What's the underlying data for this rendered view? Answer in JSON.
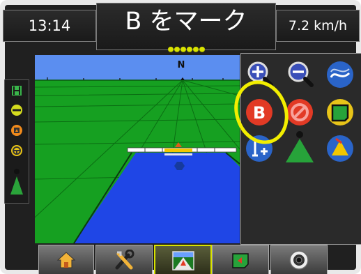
{
  "status_bar": {
    "time": "13:14",
    "screen_title": "B をマーク",
    "speed": "7.2 km/h",
    "gps_indicator_count": 6
  },
  "map": {
    "heading_label": "N",
    "colors": {
      "sky": "#5b8ef0",
      "field": "#16a021",
      "coverage": "#1f46e6",
      "boom": "#ffffff",
      "boom_center": "#f2c700"
    }
  },
  "left_bar": {
    "icons": [
      "guidance-icon",
      "lightbar-icon",
      "boom-status-icon",
      "steering-icon",
      "vehicle-direction-icon"
    ]
  },
  "right_panel": {
    "buttons": [
      {
        "name": "zoom-in-button",
        "icon": "zoom-in-icon"
      },
      {
        "name": "zoom-out-button",
        "icon": "zoom-out-icon"
      },
      {
        "name": "guidance-mode-button",
        "icon": "curved-guidance-icon"
      },
      {
        "name": "mark-b-button",
        "icon": "mark-b-icon",
        "label": "B",
        "highlighted": true
      },
      {
        "name": "cancel-mark-button",
        "icon": "cancel-icon"
      },
      {
        "name": "boundary-button",
        "icon": "boundary-icon"
      },
      {
        "name": "add-point-button",
        "icon": "marker-plus-icon"
      },
      {
        "name": "vehicle-view-button",
        "icon": "vehicle-view-icon"
      },
      {
        "name": "perspective-view-button",
        "icon": "perspective-view-icon"
      }
    ],
    "highlight_color": "#f2ee00"
  },
  "bottom_bar": {
    "buttons": [
      {
        "name": "home-button",
        "icon": "home-icon"
      },
      {
        "name": "tools-button",
        "icon": "tools-icon"
      },
      {
        "name": "guidance-view-button",
        "icon": "guidance-view-icon",
        "selected": true
      },
      {
        "name": "field-map-button",
        "icon": "map-icon"
      },
      {
        "name": "rear-view-button",
        "icon": "camera-icon"
      }
    ]
  }
}
